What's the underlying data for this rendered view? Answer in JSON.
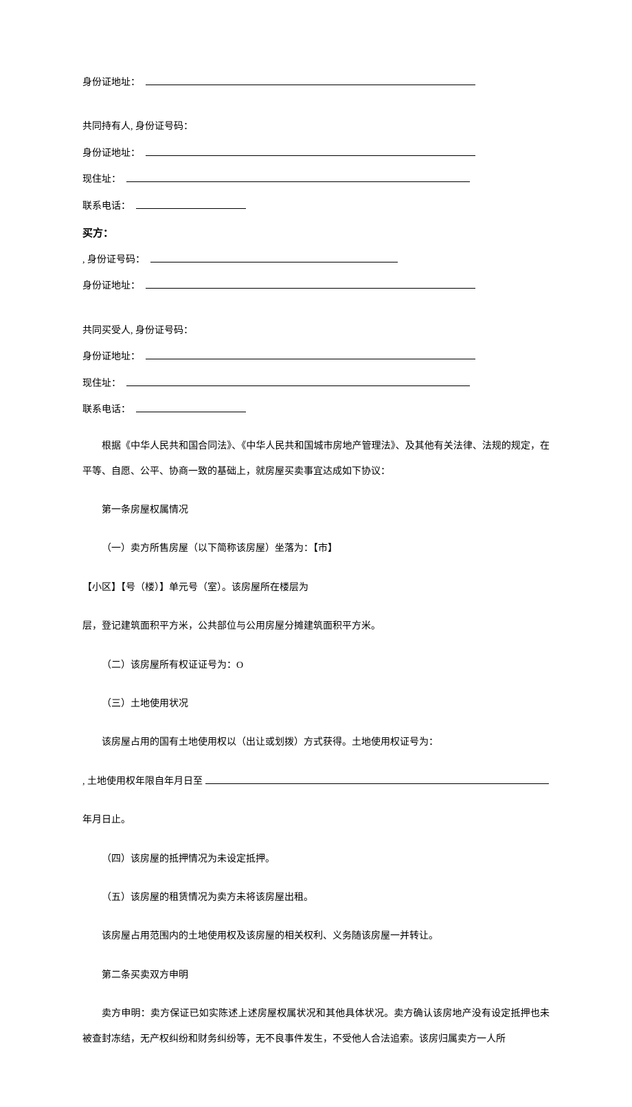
{
  "seller": {
    "id_address_label": "身份证地址：",
    "coholder_label": "共同持有人, 身份证号码：",
    "coholder_id_address_label": "身份证地址：",
    "current_address_label": "现住址：",
    "phone_label": "联系电话："
  },
  "buyer": {
    "heading": "买方：",
    "id_number_label": ", 身份证号码：",
    "id_address_label": "身份证地址：",
    "cobuyer_label": "共同买受人, 身份证号码：",
    "cobuyer_id_address_label": "身份证地址：",
    "current_address_label": "现住址：",
    "phone_label": "联系电话："
  },
  "body": {
    "p1": "根据《中华人民共和国合同法》、《中华人民共和国城市房地产管理法》、及其他有关法律、法规的规定，在平等、自愿、公平、协商一致的基础上，就房屋买卖事宜达成如下协议：",
    "p2": "第一条房屋权属情况",
    "p3": "（一）卖方所售房屋（以下简称该房屋）坐落为：【市】",
    "p4": "【小区】【号（楼）】单元号（室）。该房屋所在楼层为",
    "p5": "层，登记建筑面积平方米，公共部位与公用房屋分摊建筑面积平方米。",
    "p6": "（二）该房屋所有权证证号为：O",
    "p7": "（三）土地使用状况",
    "p8": "该房屋占用的国有土地使用权以（出让或划拨）方式获得。土地使用权证号为：",
    "p9_prefix": ", 土地使用权年限自年月日至",
    "p10": "年月日止。",
    "p11": "（四）该房屋的抵押情况为未设定抵押。",
    "p12": "（五）该房屋的租赁情况为卖方未将该房屋出租。",
    "p13": "该房屋占用范围内的土地使用权及该房屋的相关权利、义务随该房屋一并转让。",
    "p14": "第二条买卖双方申明",
    "p15": "卖方申明：卖方保证已如实陈述上述房屋权属状况和其他具体状况。卖方确认该房地产没有设定抵押也未被查封冻结，无产权纠纷和财务纠纷等，无不良事件发生，不受他人合法追索。该房归属卖方一人所"
  }
}
